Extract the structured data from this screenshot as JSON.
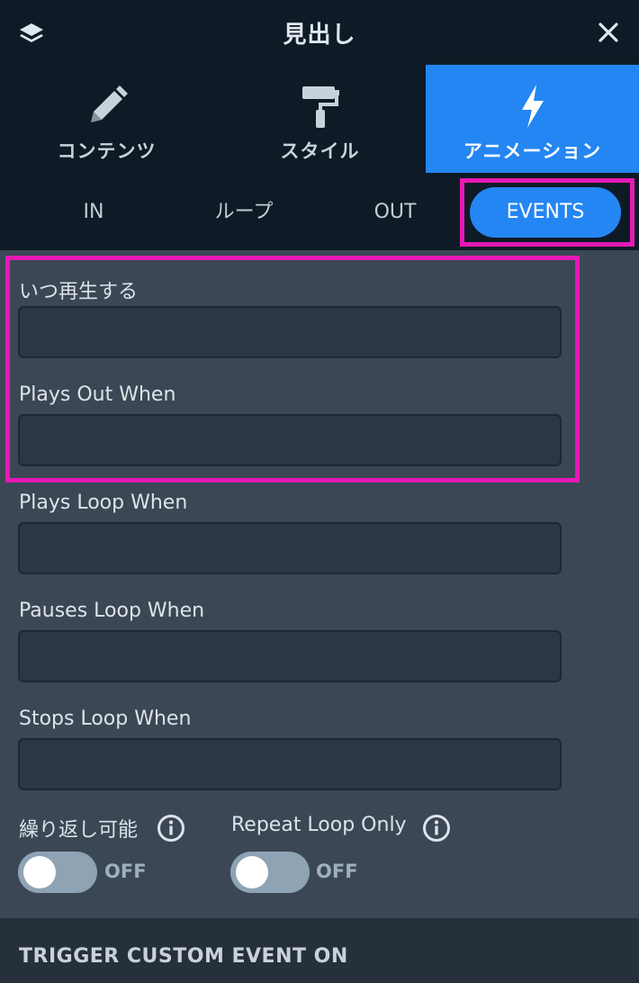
{
  "header": {
    "title": "見出し",
    "layers_icon": "layers-icon",
    "close_icon": "close-icon"
  },
  "main_tabs": [
    {
      "label": "コンテンツ",
      "icon": "pencil-icon",
      "active": false
    },
    {
      "label": "スタイル",
      "icon": "paint-roller-icon",
      "active": false
    },
    {
      "label": "アニメーション",
      "icon": "lightning-bolt-icon",
      "active": true
    }
  ],
  "sub_tabs": [
    {
      "label": "IN",
      "active": false
    },
    {
      "label": "ループ",
      "active": false
    },
    {
      "label": "OUT",
      "active": false
    },
    {
      "label": "EVENTS",
      "active": true
    }
  ],
  "fields": [
    {
      "label": "いつ再生する",
      "value": ""
    },
    {
      "label": "Plays Out When",
      "value": ""
    },
    {
      "label": "Plays Loop When",
      "value": ""
    },
    {
      "label": "Pauses Loop When",
      "value": ""
    },
    {
      "label": "Stops Loop When",
      "value": ""
    }
  ],
  "toggles": [
    {
      "label": "繰り返し可能",
      "state": "OFF",
      "on": false,
      "icon": "info-icon"
    },
    {
      "label": "Repeat Loop Only",
      "state": "OFF",
      "on": false,
      "icon": "info-icon"
    }
  ],
  "section_footer": {
    "title": "TRIGGER CUSTOM EVENT ON"
  },
  "colors": {
    "accent": "#2486f2",
    "highlight": "#e619b4",
    "header_bg": "#0e1a26",
    "panel_bg": "#3b4754"
  }
}
